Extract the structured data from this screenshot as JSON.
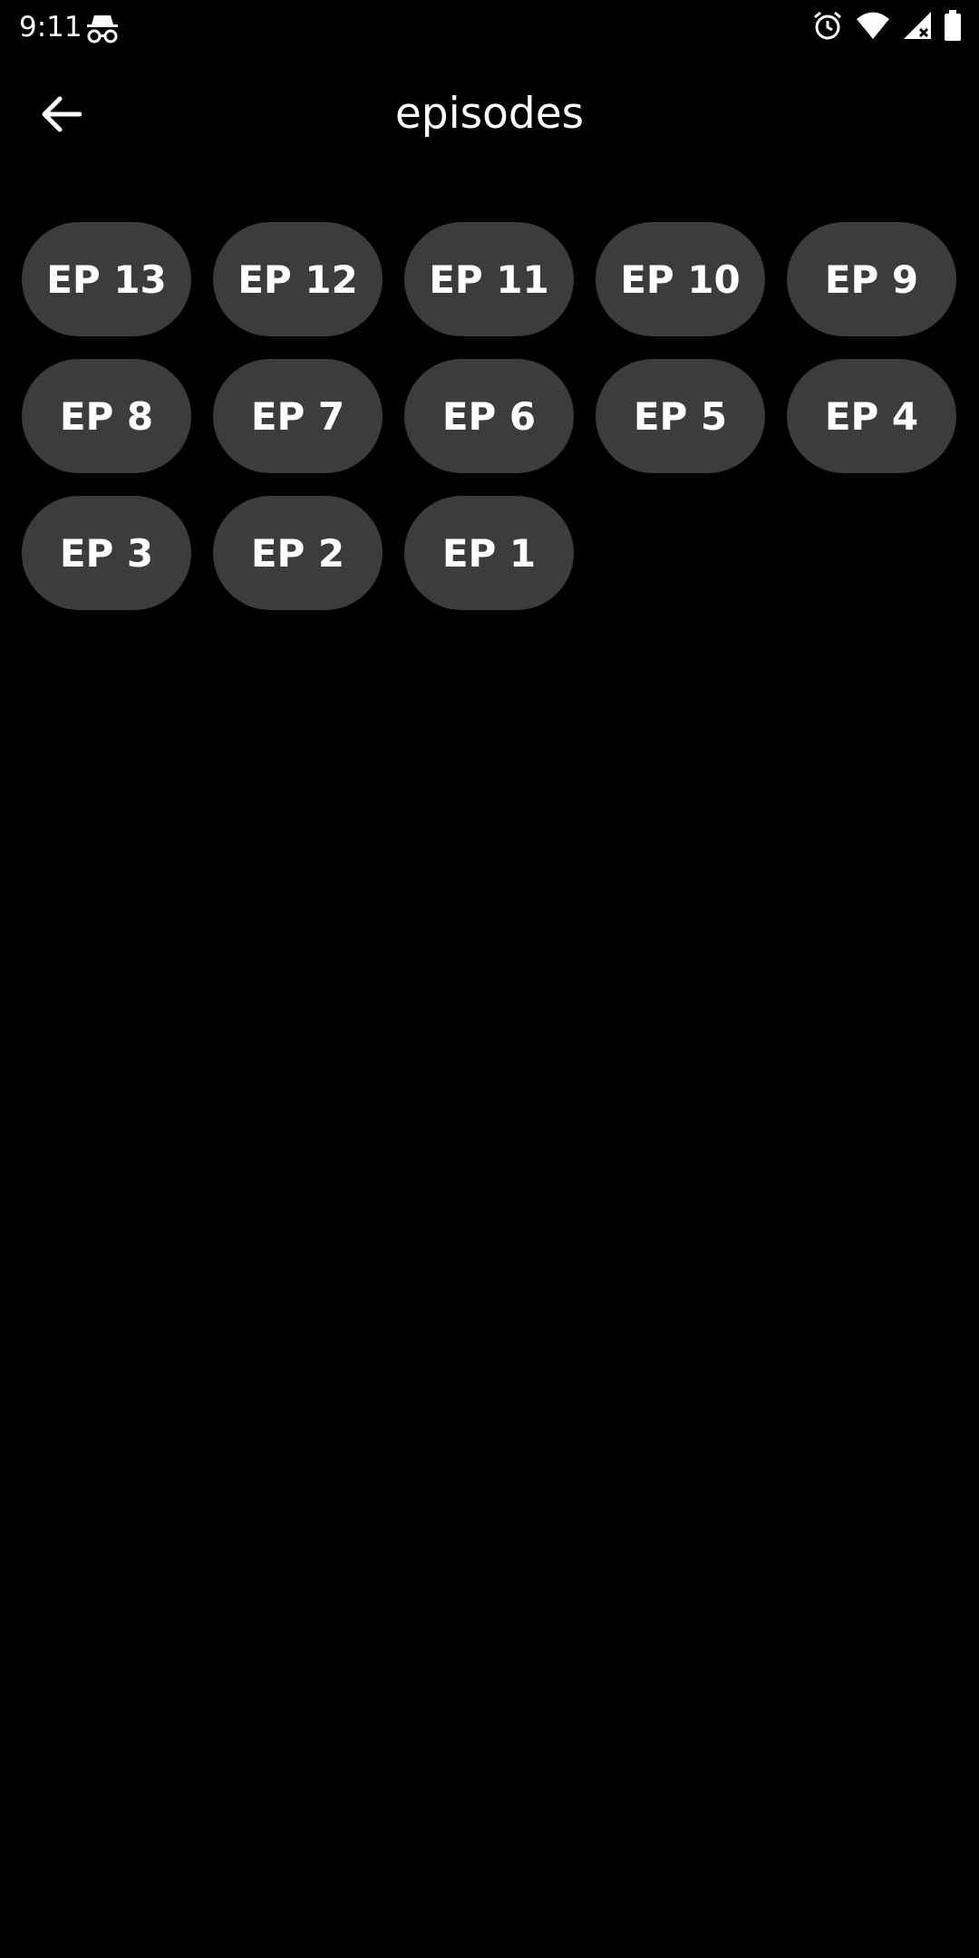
{
  "status_bar": {
    "time": "9:11",
    "left_icons": [
      "incognito-icon"
    ],
    "right_icons": [
      "alarm-icon",
      "wifi-icon",
      "signal-icon",
      "battery-icon"
    ]
  },
  "app_bar": {
    "back_icon": "arrow-left-icon",
    "title": "episodes"
  },
  "episodes": [
    {
      "label": "EP 13"
    },
    {
      "label": "EP 12"
    },
    {
      "label": "EP 11"
    },
    {
      "label": "EP 10"
    },
    {
      "label": "EP 9"
    },
    {
      "label": "EP 8"
    },
    {
      "label": "EP 7"
    },
    {
      "label": "EP 6"
    },
    {
      "label": "EP 5"
    },
    {
      "label": "EP 4"
    },
    {
      "label": "EP 3"
    },
    {
      "label": "EP 2"
    },
    {
      "label": "EP 1"
    }
  ],
  "colors": {
    "background": "#000000",
    "chip_background": "#3c3c3c",
    "text": "#ffffff"
  }
}
